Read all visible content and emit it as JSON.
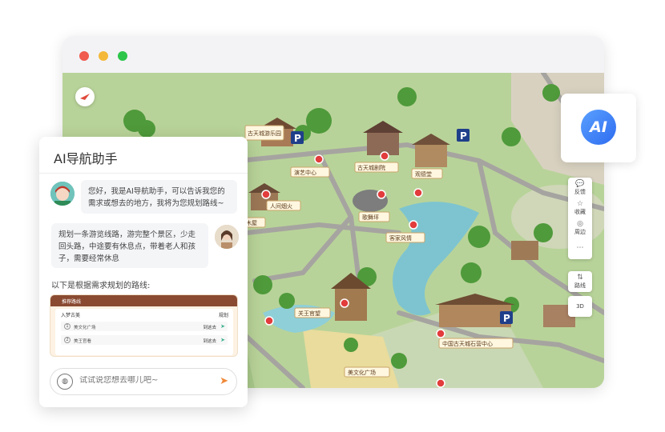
{
  "window": {
    "controls": [
      "close",
      "minimize",
      "maximize"
    ]
  },
  "map": {
    "labels": [
      "演艺中心",
      "古天城剧院",
      "观德堂",
      "人间烟火",
      "歌舞坪",
      "客家风情",
      "关王官望",
      "中国古天城石营中心",
      "美文化广场",
      "木屋",
      "古天城游乐园"
    ],
    "parking_label": "P",
    "tools": [
      {
        "label": "反馈",
        "icon": "feedback-icon",
        "glyph": "💬"
      },
      {
        "label": "收藏",
        "icon": "star-icon",
        "glyph": "☆"
      },
      {
        "label": "周边",
        "icon": "around-icon",
        "glyph": "◎"
      },
      {
        "label": "",
        "icon": "more-icon",
        "glyph": "⋯"
      }
    ],
    "route_tool": {
      "label": "路线",
      "glyph": "⇅"
    },
    "view_tool": {
      "label": "3D"
    }
  },
  "ai_badge": {
    "text": "AI"
  },
  "chat": {
    "title": "AI导航助手",
    "bot_message": "您好，我是AI导航助手，可以告诉我您的需求或想去的地方，我将为您规划路线~",
    "user_message": "规划一条游览线路，游完整个景区，少走回头路，中途要有休息点，带着老人和孩子，需要经常休息",
    "plan_intro": "以下是根据需求规划的路线:",
    "route_card": {
      "header": "推荐路线",
      "subtitle": "入梦古美",
      "plan_label": "规划",
      "items": [
        {
          "num": "1",
          "name": "美文化广场",
          "action": "到这去"
        },
        {
          "num": "2",
          "name": "美王官看",
          "action": "到这去"
        }
      ]
    },
    "input_placeholder": "试试说您想去哪儿吧~"
  },
  "colors": {
    "accent_blue": "#2e6cf0",
    "route_header": "#8a4a32",
    "send_orange": "#f0893a"
  }
}
